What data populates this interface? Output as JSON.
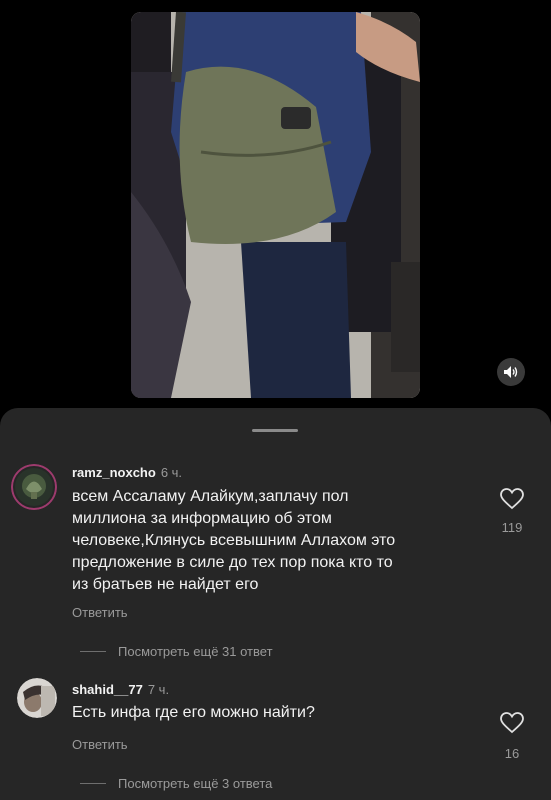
{
  "comments": [
    {
      "username": "ramz_noxcho",
      "time": "6 ч.",
      "text_lines": [
        "всем Ассаламу Алайкум,заплачу пол",
        "миллиона за информацию об этом",
        "человеке,Клянусь всевышним Аллахом это",
        "предложение в силе до тех пор пока кто то",
        "из братьев не найдет его"
      ],
      "reply_label": "Ответить",
      "likes": "119",
      "more_replies": "Посмотреть ещё 31 ответ"
    },
    {
      "username": "shahid__77",
      "time": "7 ч.",
      "text_lines": [
        "Есть инфа где его можно найти?"
      ],
      "reply_label": "Ответить",
      "likes": "16",
      "more_replies": "Посмотреть ещё 3 ответа"
    }
  ],
  "icons": {
    "mute": "speaker-icon",
    "like": "heart-icon"
  }
}
